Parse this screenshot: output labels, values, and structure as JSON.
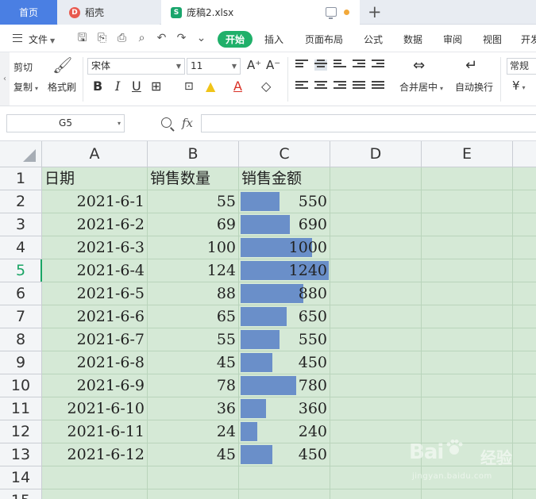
{
  "tabs": {
    "home": "首页",
    "daoke": "稻壳",
    "file": "庞稿2.xlsx"
  },
  "menu": {
    "file": "文件",
    "start": "开始",
    "insert": "插入",
    "page_layout": "页面布局",
    "formula": "公式",
    "data": "数据",
    "review": "审阅",
    "view": "视图",
    "developer": "开发"
  },
  "ribbon": {
    "cut": "剪切",
    "copy": "复制",
    "format_painter": "格式刷",
    "font_name": "宋体",
    "font_size": "11",
    "merge_center": "合并居中",
    "wrap_text": "自动换行",
    "number_format": "常规",
    "currency": "¥"
  },
  "formula_bar": {
    "name_box": "G5",
    "fx": "fx",
    "formula": ""
  },
  "sheet": {
    "columns": [
      "A",
      "B",
      "C",
      "D",
      "E"
    ],
    "rows": [
      "1",
      "2",
      "3",
      "4",
      "5",
      "6",
      "7",
      "8",
      "9",
      "10",
      "11",
      "12",
      "13",
      "14",
      "15"
    ],
    "active_row": "5",
    "headers": [
      "日期",
      "销售数量",
      "销售金额"
    ],
    "data": [
      {
        "date": "2021-6-1",
        "qty": 55,
        "amount": 550
      },
      {
        "date": "2021-6-2",
        "qty": 69,
        "amount": 690
      },
      {
        "date": "2021-6-3",
        "qty": 100,
        "amount": 1000
      },
      {
        "date": "2021-6-4",
        "qty": 124,
        "amount": 1240
      },
      {
        "date": "2021-6-5",
        "qty": 88,
        "amount": 880
      },
      {
        "date": "2021-6-6",
        "qty": 65,
        "amount": 650
      },
      {
        "date": "2021-6-7",
        "qty": 55,
        "amount": 550
      },
      {
        "date": "2021-6-8",
        "qty": 45,
        "amount": 450
      },
      {
        "date": "2021-6-9",
        "qty": 78,
        "amount": 780
      },
      {
        "date": "2021-6-10",
        "qty": 36,
        "amount": 360
      },
      {
        "date": "2021-6-11",
        "qty": 24,
        "amount": 240
      },
      {
        "date": "2021-6-12",
        "qty": 45,
        "amount": 450
      }
    ],
    "databar_color": "#6a8fc9",
    "grid_background": "#d5e9d6"
  },
  "watermark": {
    "brand": "Bai",
    "brand_tail": "经验",
    "url": "jingyan.baidu.com"
  }
}
